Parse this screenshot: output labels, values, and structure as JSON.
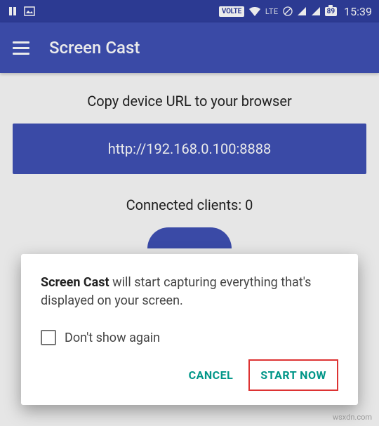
{
  "statusbar": {
    "volte": "VOLTE",
    "lte": "LTE",
    "battery": "89",
    "time": "15:39"
  },
  "appbar": {
    "title": "Screen Cast"
  },
  "main": {
    "instruction": "Copy device URL to your browser",
    "url": "http://192.168.0.100:8888",
    "clients_label": "Connected clients:",
    "clients_count": "0"
  },
  "dialog": {
    "app_name": "Screen Cast",
    "message_suffix": " will start capturing everything that's displayed on your screen.",
    "dont_show": "Don't show again",
    "cancel": "CANCEL",
    "start": "START NOW"
  },
  "watermark": "wsxdn.com"
}
